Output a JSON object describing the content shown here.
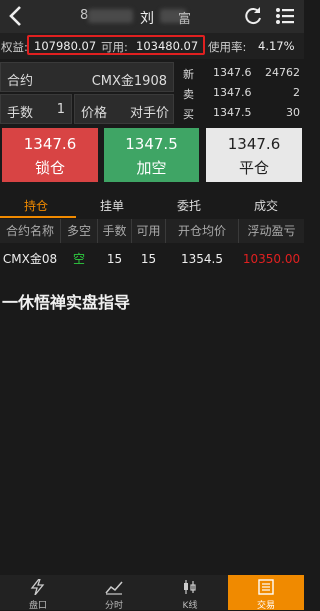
{
  "header": {
    "title_visible": "刘",
    "title_rest": "富",
    "code_fragment": "8"
  },
  "account": {
    "equity_label": "权益:",
    "equity_value": "107980.07",
    "available_label": "可用:",
    "available_value": "103480.07",
    "usage_label": "使用率:",
    "usage_value": "4.17%"
  },
  "order_form": {
    "contract_label": "合约",
    "contract_value": "CMX金1908",
    "qty_label": "手数",
    "qty_value": "1",
    "price_label": "价格",
    "price_value": "对手价"
  },
  "quotes": [
    {
      "label": "新",
      "price": "1347.6",
      "volume": "24762"
    },
    {
      "label": "卖",
      "price": "1347.6",
      "volume": "2"
    },
    {
      "label": "买",
      "price": "1347.5",
      "volume": "30"
    }
  ],
  "actions": {
    "lock": {
      "price": "1347.6",
      "label": "锁仓"
    },
    "add_short": {
      "price": "1347.5",
      "label": "加空"
    },
    "close": {
      "price": "1347.6",
      "label": "平仓"
    }
  },
  "tabs": [
    "持仓",
    "挂单",
    "委托",
    "成交"
  ],
  "table": {
    "headers": [
      "合约名称",
      "多空",
      "手数",
      "可用",
      "开仓均价",
      "浮动盈亏"
    ],
    "rows": [
      {
        "name": "CMX金08",
        "side": "空",
        "qty": "15",
        "avail": "15",
        "avg": "1354.5",
        "pnl": "10350.00"
      }
    ]
  },
  "watermark": "一休悟禅实盘指导",
  "bottom_nav": [
    "盘口",
    "分时",
    "K线",
    "交易"
  ],
  "colors": {
    "accent": "#f08a00",
    "red": "#d84040",
    "green": "#3fa565",
    "gray_btn": "#e8e8e8",
    "pnl_red": "#e02020",
    "short_green": "#2ecc40"
  }
}
